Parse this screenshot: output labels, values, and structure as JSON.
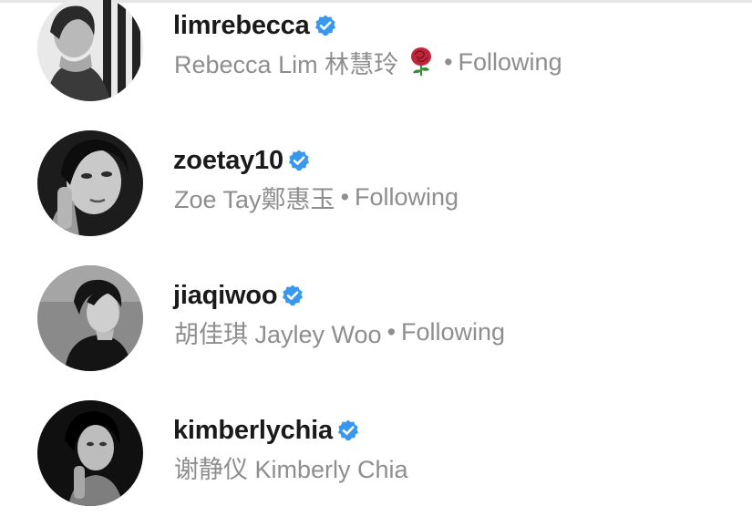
{
  "accounts": [
    {
      "username": "limrebecca",
      "display_name": "Rebecca Lim 林慧玲",
      "emoji": "rose",
      "separator": "•",
      "status": "Following",
      "verified": true
    },
    {
      "username": "zoetay10",
      "display_name": "Zoe Tay鄭惠玉",
      "separator": "•",
      "status": "Following",
      "verified": true
    },
    {
      "username": "jiaqiwoo",
      "display_name": "胡佳琪 Jayley Woo",
      "separator": "•",
      "status": "Following",
      "verified": true
    },
    {
      "username": "kimberlychia",
      "display_name": "谢静仪 Kimberly Chia",
      "verified": true
    }
  ],
  "colors": {
    "verified_badge": "#3897f0",
    "username_text": "#1a1a1a",
    "subtitle_text": "#8e8e8e",
    "rose": "#c0263b"
  }
}
